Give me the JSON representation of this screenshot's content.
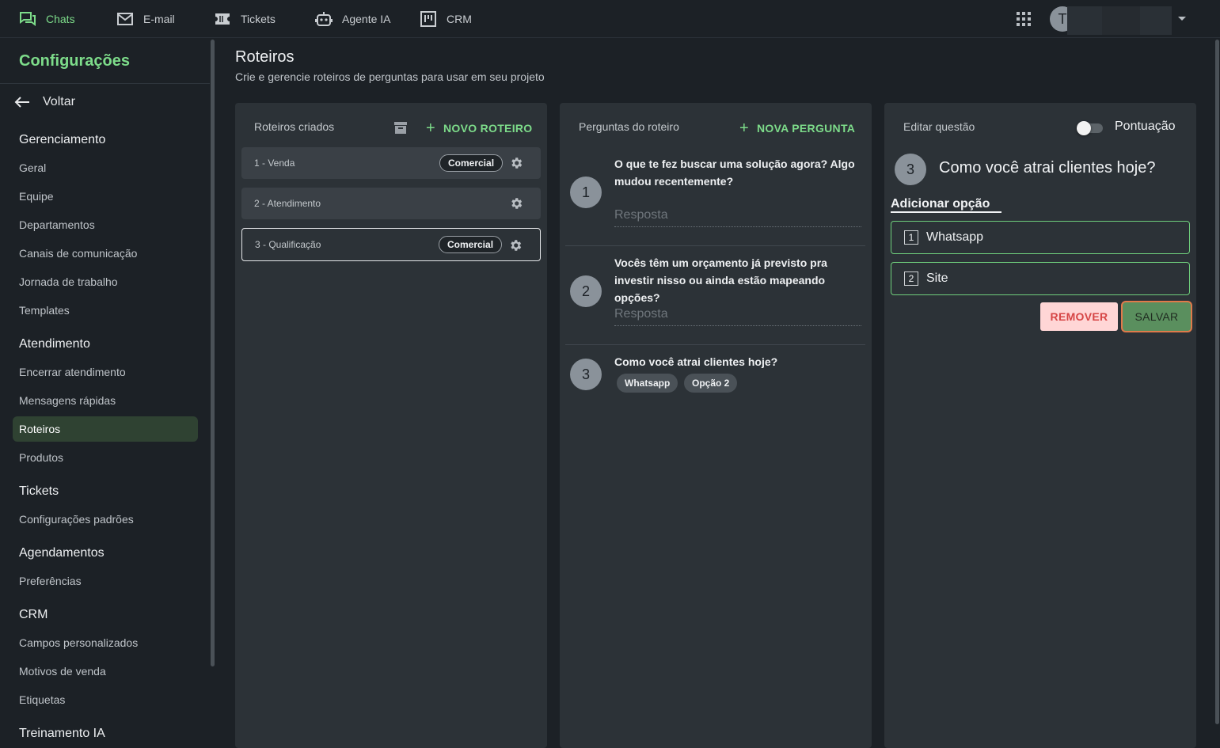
{
  "topnav": {
    "items": [
      {
        "label": "Chats",
        "icon": "chat-icon",
        "active": true
      },
      {
        "label": "E-mail",
        "icon": "mail-icon"
      },
      {
        "label": "Tickets",
        "icon": "ticket-icon"
      },
      {
        "label": "Agente IA",
        "icon": "robot-icon"
      },
      {
        "label": "CRM",
        "icon": "kanban-icon"
      }
    ],
    "avatar_initial": "T"
  },
  "sidebar": {
    "title": "Configurações",
    "back_label": "Voltar",
    "sections": [
      {
        "title": "Gerenciamento",
        "items": [
          "Geral",
          "Equipe",
          "Departamentos",
          "Canais de comunicação",
          "Jornada de trabalho",
          "Templates"
        ]
      },
      {
        "title": "Atendimento",
        "items": [
          "Encerrar atendimento",
          "Mensagens rápidas",
          "Roteiros",
          "Produtos"
        ]
      },
      {
        "title": "Tickets",
        "items": [
          "Configurações padrões"
        ]
      },
      {
        "title": "Agendamentos",
        "items": [
          "Preferências"
        ]
      },
      {
        "title": "CRM",
        "items": [
          "Campos personalizados",
          "Motivos de venda",
          "Etiquetas"
        ]
      },
      {
        "title": "Treinamento IA",
        "items": []
      }
    ],
    "active_item": "Roteiros"
  },
  "header": {
    "title": "Roteiros",
    "subtitle": "Crie e gerencie roteiros de perguntas para usar em seu projeto"
  },
  "scripts_panel": {
    "title": "Roteiros criados",
    "new_button": "NOVO ROTEIRO",
    "scripts": [
      {
        "label": "1 - Venda",
        "tag": "Comercial"
      },
      {
        "label": "2 - Atendimento",
        "tag": ""
      },
      {
        "label": "3 - Qualificação",
        "tag": "Comercial"
      }
    ],
    "selected_index": 2
  },
  "questions_panel": {
    "title": "Perguntas do roteiro",
    "new_button": "NOVA PERGUNTA",
    "answer_placeholder": "Resposta",
    "questions": [
      {
        "number": "1",
        "text": "O que te fez buscar uma solução agora? Algo mudou recentemente?"
      },
      {
        "number": "2",
        "text": "Vocês têm um orçamento já previsto pra investir nisso ou ainda estão mapeando opções?"
      },
      {
        "number": "3",
        "text": "Como você atrai clientes hoje?",
        "options": [
          "Whatsapp",
          "Opção 2"
        ]
      }
    ]
  },
  "edit_panel": {
    "title": "Editar questão",
    "toggle_label": "Pontuação",
    "toggle_on": false,
    "question_number": "3",
    "question_text": "Como você atrai clientes hoje?",
    "add_option_label": "Adicionar opção",
    "options": [
      {
        "number": "1",
        "value": "Whatsapp"
      },
      {
        "number": "2",
        "value": "Site"
      }
    ],
    "remove_label": "REMOVER",
    "save_label": "SALVAR"
  },
  "colors": {
    "accent": "#7ddc8a",
    "background": "#1c2126",
    "panel": "#2c3237",
    "danger": "#d64545"
  }
}
